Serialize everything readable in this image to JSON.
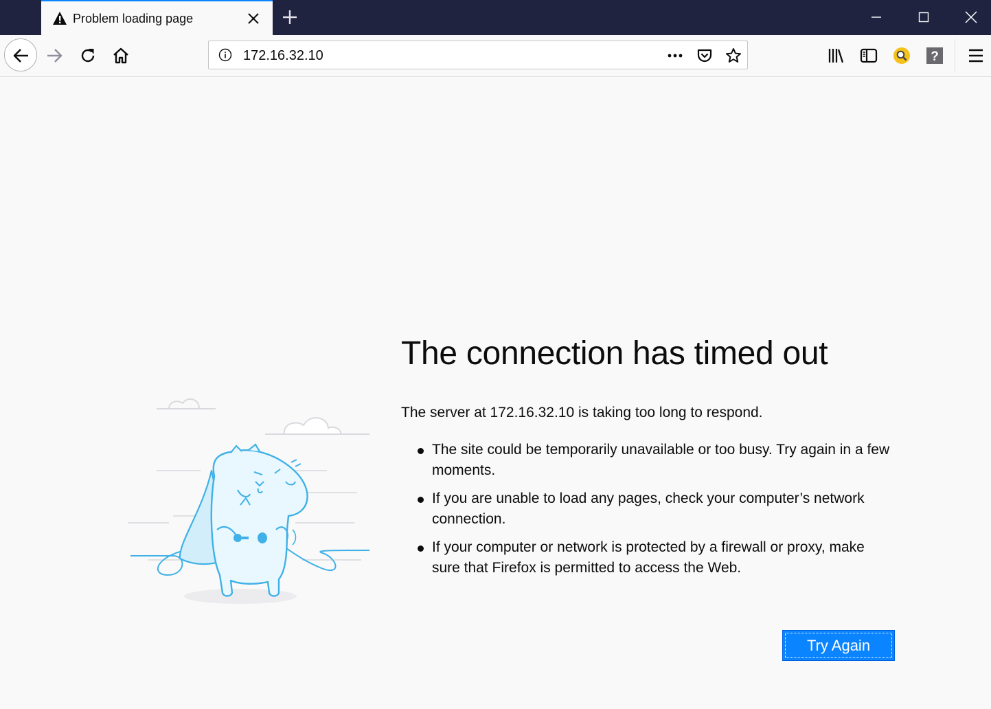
{
  "tab": {
    "title": "Problem loading page",
    "icon": "warning-icon"
  },
  "window_controls": [
    "minimize-icon",
    "maximize-icon",
    "close-icon"
  ],
  "navbar": {
    "url": "172.16.32.10",
    "buttons": [
      "back-icon",
      "forward-icon",
      "reload-icon",
      "home-icon"
    ],
    "url_actions": [
      "page-actions-icon",
      "pocket-icon",
      "bookmark-star-icon"
    ],
    "toolbar_icons": [
      "library-icon",
      "sidebar-icon",
      "extension-search-icon",
      "help-extension-icon",
      "hamburger-menu-icon"
    ]
  },
  "error": {
    "title": "The connection has timed out",
    "description": "The server at 172.16.32.10 is taking too long to respond.",
    "bullets": [
      "The site could be temporarily unavailable or too busy. Try again in a few moments.",
      "If you are unable to load any pages, check your computer’s network connection.",
      "If your computer or network is protected by a firewall or proxy, make sure that Firefox is permitted to access the Web."
    ],
    "button": "Try Again"
  },
  "colors": {
    "tabstrip": "#1f2340",
    "accent": "#0a84ff",
    "page_bg": "#f9f9fa",
    "illustration_stroke": "#3fb1e6",
    "illustration_fill": "#e3f5fd"
  }
}
